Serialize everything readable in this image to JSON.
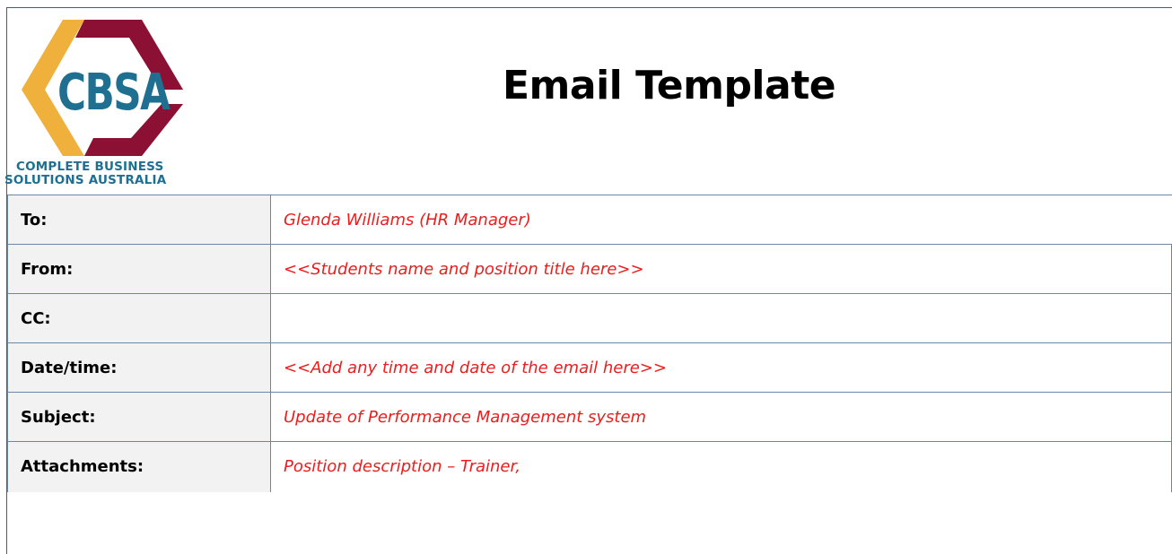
{
  "logo": {
    "mark_text": "CBSA",
    "line1": "COMPLETE BUSINESS",
    "line2": "SOLUTIONS AUSTRALIA",
    "colors": {
      "gold": "#f0b03c",
      "maroon": "#8b1033",
      "teal": "#1f6f90"
    }
  },
  "title": "Email Template",
  "rows": [
    {
      "label": "To:",
      "value": "Glenda Williams (HR Manager)"
    },
    {
      "label": "From:",
      "value": "<<Students name and position title here>>"
    },
    {
      "label": "CC:",
      "value": ""
    },
    {
      "label": "Date/time:",
      "value": "<<Add any time and date of the email here>>"
    },
    {
      "label": "Subject:",
      "value": "Update of Performance Management system"
    },
    {
      "label": "Attachments:",
      "value": "Position description – Trainer,"
    }
  ],
  "colors": {
    "value_text": "#ee1c1c",
    "label_bg": "#f2f2f2",
    "border": "#6c86a8"
  }
}
